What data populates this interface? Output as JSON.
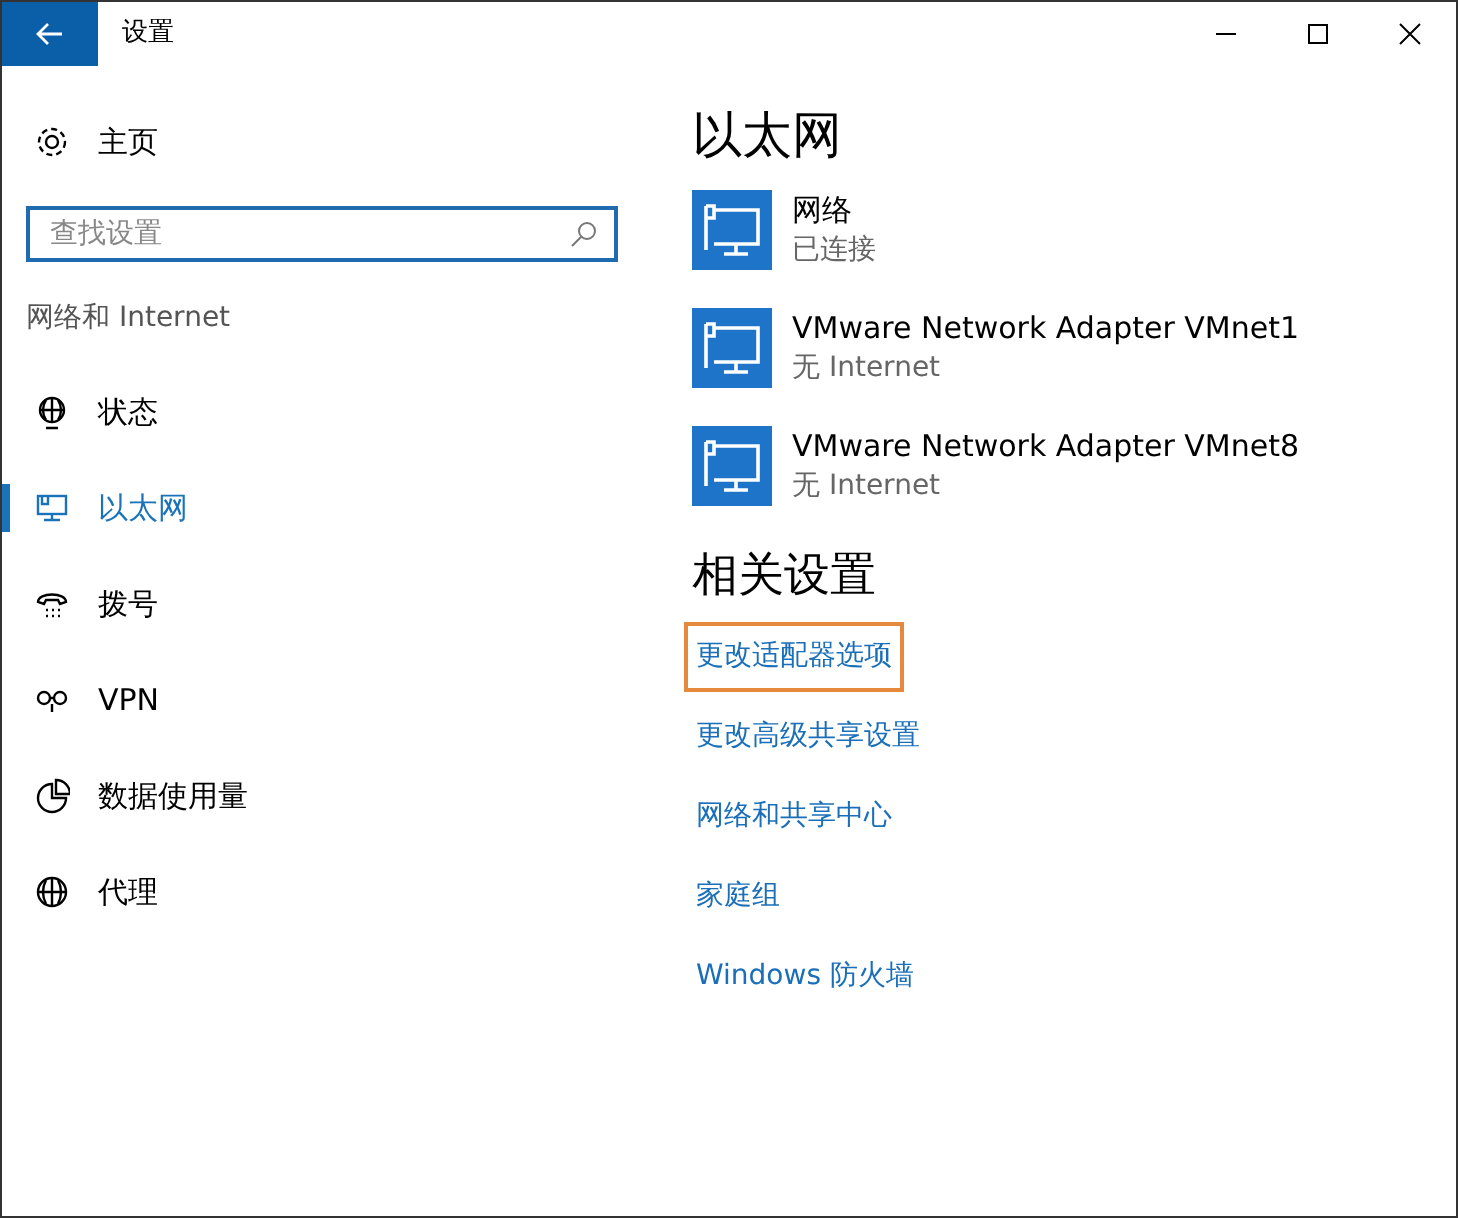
{
  "window": {
    "title": "设置"
  },
  "sidebar": {
    "home": "主页",
    "search": {
      "placeholder": "查找设置"
    },
    "section": "网络和 Internet",
    "items": [
      {
        "label": "状态",
        "selected": false
      },
      {
        "label": "以太网",
        "selected": true
      },
      {
        "label": "拨号",
        "selected": false
      },
      {
        "label": "VPN",
        "selected": false
      },
      {
        "label": "数据使用量",
        "selected": false
      },
      {
        "label": "代理",
        "selected": false
      }
    ]
  },
  "content": {
    "title": "以太网",
    "networks": [
      {
        "name": "网络",
        "status": "已连接"
      },
      {
        "name": "VMware Network Adapter VMnet1",
        "status": "无 Internet"
      },
      {
        "name": "VMware Network Adapter VMnet8",
        "status": "无 Internet"
      }
    ],
    "related_title": "相关设置",
    "links": [
      {
        "label": "更改适配器选项",
        "highlighted": true
      },
      {
        "label": "更改高级共享设置",
        "highlighted": false
      },
      {
        "label": "网络和共享中心",
        "highlighted": false
      },
      {
        "label": "家庭组",
        "highlighted": false
      },
      {
        "label": "Windows 防火墙",
        "highlighted": false
      }
    ]
  }
}
